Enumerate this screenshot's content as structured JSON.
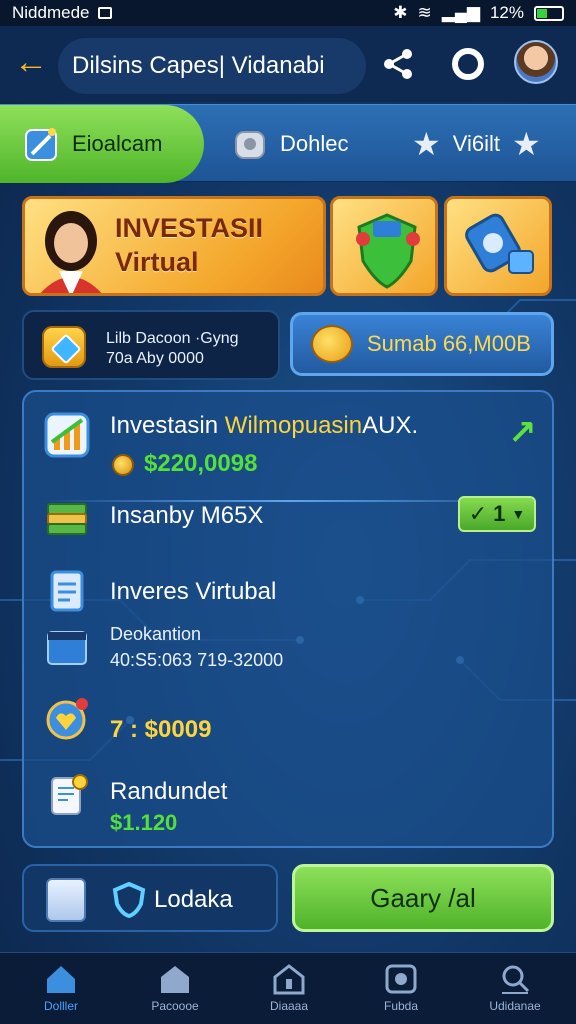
{
  "status_bar": {
    "left_text": "Niddmede",
    "time": "12%"
  },
  "header": {
    "title": "Dilsins Capes| Vidanabi"
  },
  "tabs": [
    {
      "label": "Eioalcam"
    },
    {
      "label": "Dohlec"
    },
    {
      "label": "Vi6ilt"
    }
  ],
  "promo": {
    "line1": "INVESTASII",
    "line2": "Virtual"
  },
  "balance": {
    "line1": "Lilb Dacoon ·Gyng",
    "line2": "70a Aby 0000",
    "action_label": "Sumab 66,M00B"
  },
  "panel": {
    "item1": {
      "title_plain": "Investasin",
      "title_gold": "Wilmopuasin",
      "title_end": "AUX.",
      "amount": "$220,0098"
    },
    "item2": {
      "title": "Insanby M65X",
      "badge": "1"
    },
    "item3": {
      "title": "Inveres Virtubal",
      "sub_label": "Deokantion",
      "sub_value": "40:S5:063 719-32000"
    },
    "item4": {
      "amount": "7 : $0009"
    },
    "item5": {
      "title": "Randundet",
      "amount": "$1.120"
    }
  },
  "actions": {
    "secondary": "Lodaka",
    "primary": "Gaary /al"
  },
  "bottom_nav": [
    {
      "label": "Dolller",
      "icon": "home-icon"
    },
    {
      "label": "Pacoooe",
      "icon": "store-icon"
    },
    {
      "label": "Diaaaa",
      "icon": "house-outline-icon"
    },
    {
      "label": "Fubda",
      "icon": "gamepad-icon"
    },
    {
      "label": "Udidanae",
      "icon": "search-icon"
    }
  ],
  "colors": {
    "accent_green": "#54e03a",
    "accent_gold": "#ffd43a",
    "background": "#123a6b"
  }
}
